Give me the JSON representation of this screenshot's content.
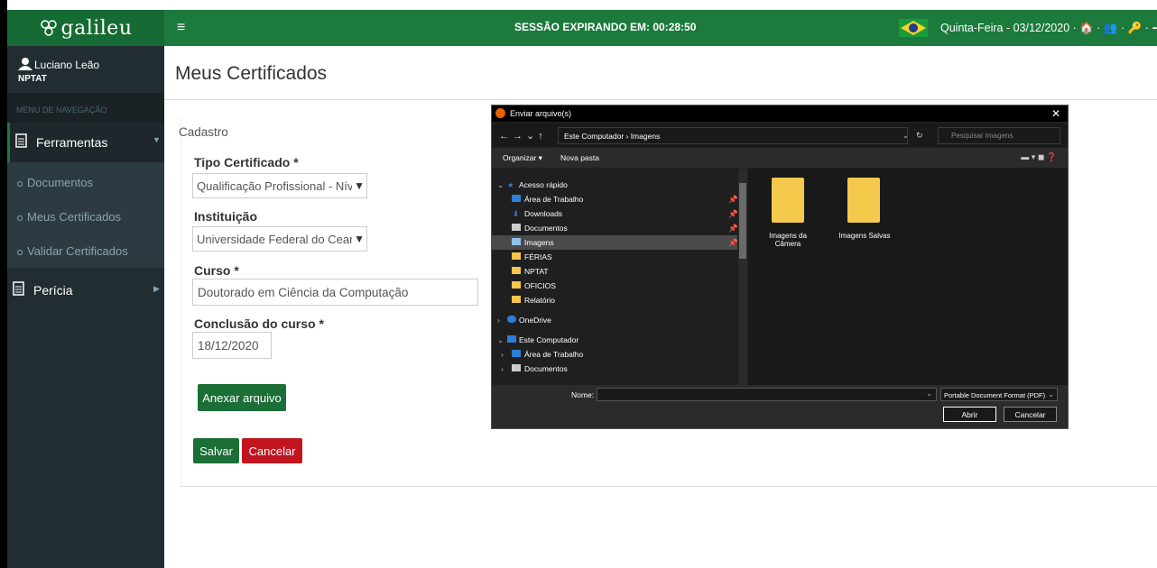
{
  "app": {
    "logo_text": "galileu",
    "menu_icon": "hamburger-icon"
  },
  "topbar": {
    "session": "SESSÃO EXPIRANDO EM: 00:28:50",
    "date_info": "Quinta-Feira - 03/12/2020 · 🏠 · 👥 · 🔑 · ➜"
  },
  "user": {
    "name": "Luciano Leão",
    "unit": "NPTAT"
  },
  "sidebar": {
    "nav_header": "MENU DE NAVEGAÇÃO",
    "tools_label": "Ferramentas",
    "sub_items": [
      {
        "label": "Documentos"
      },
      {
        "label": "Meus Certificados"
      },
      {
        "label": "Validar Certificados"
      }
    ],
    "pericia_label": "Perícia"
  },
  "main": {
    "title": "Meus Certificados",
    "section": "Cadastro",
    "tipo_label": "Tipo Certificado *",
    "tipo_value": "Qualificação Profissional - Nível",
    "inst_label": "Instituição",
    "inst_value": "Universidade Federal do Ceará",
    "curso_label": "Curso *",
    "curso_value": "Doutorado em Ciência da Computação",
    "conclusao_label": "Conclusão do curso *",
    "conclusao_value": "18/12/2020",
    "anexar_label": "Anexar arquivo",
    "salvar_label": "Salvar",
    "cancelar_label": "Cancelar"
  },
  "dialog": {
    "title": "Enviar arquivo(s)",
    "path": "Este Computador  ›  Imagens",
    "search_placeholder": "Pesquisar Imagens",
    "organizar": "Organizar ▾",
    "nova_pasta": "Nova pasta",
    "tree": [
      {
        "label": "Acesso rápido",
        "kind": "star"
      },
      {
        "label": "Área de Trabalho",
        "kind": "blue"
      },
      {
        "label": "Downloads",
        "kind": "download"
      },
      {
        "label": "Documentos",
        "kind": "doc"
      },
      {
        "label": "Imagens",
        "kind": "img"
      },
      {
        "label": "FÉRIAS",
        "kind": "folder"
      },
      {
        "label": "NPTAT",
        "kind": "folder"
      },
      {
        "label": "OFICIOS",
        "kind": "folder"
      },
      {
        "label": "Relatório",
        "kind": "folder"
      },
      {
        "label": "OneDrive",
        "kind": "cloud"
      },
      {
        "label": "Este Computador",
        "kind": "pc"
      },
      {
        "label": "Área de Trabalho",
        "kind": "blue"
      },
      {
        "label": "Documentos",
        "kind": "doc"
      }
    ],
    "files": [
      {
        "label": "Imagens da Câmera"
      },
      {
        "label": "Imagens Salvas"
      }
    ],
    "nome_label": "Nome:",
    "format": "Portable Document Format (PDF)",
    "abrir": "Abrir",
    "cancelar": "Cancelar"
  }
}
